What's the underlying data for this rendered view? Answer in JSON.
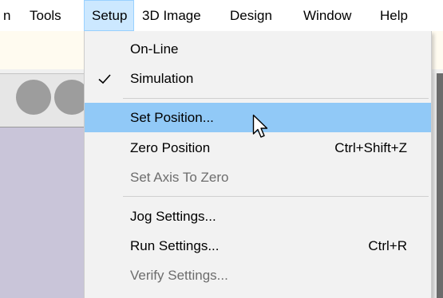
{
  "menubar": {
    "items": [
      {
        "label": "n"
      },
      {
        "label": "Tools"
      },
      {
        "label": "Setup"
      },
      {
        "label": "3D Image"
      },
      {
        "label": "Design"
      },
      {
        "label": "Window"
      },
      {
        "label": "Help"
      }
    ]
  },
  "setup_menu": {
    "items": [
      {
        "label": "On-Line",
        "shortcut": "",
        "checked": false,
        "enabled": true
      },
      {
        "label": "Simulation",
        "shortcut": "",
        "checked": true,
        "enabled": true
      },
      {
        "label": "Set Position...",
        "shortcut": "",
        "checked": false,
        "enabled": true,
        "highlighted": true
      },
      {
        "label": "Zero Position",
        "shortcut": "Ctrl+Shift+Z",
        "checked": false,
        "enabled": true
      },
      {
        "label": "Set Axis To Zero",
        "shortcut": "",
        "checked": false,
        "enabled": false
      },
      {
        "label": "Jog Settings...",
        "shortcut": "",
        "checked": false,
        "enabled": true
      },
      {
        "label": "Run Settings...",
        "shortcut": "Ctrl+R",
        "checked": false,
        "enabled": true
      },
      {
        "label": "Verify Settings...",
        "shortcut": "",
        "checked": false,
        "enabled": false
      }
    ]
  },
  "icons": {
    "check": "checkmark-icon",
    "cursor": "mouse-pointer-icon"
  },
  "colors": {
    "menu_background": "#f2f2f2",
    "highlight": "#91c9f7",
    "active_menubar": "#cce8ff",
    "disabled_text": "#6d6d6d"
  }
}
